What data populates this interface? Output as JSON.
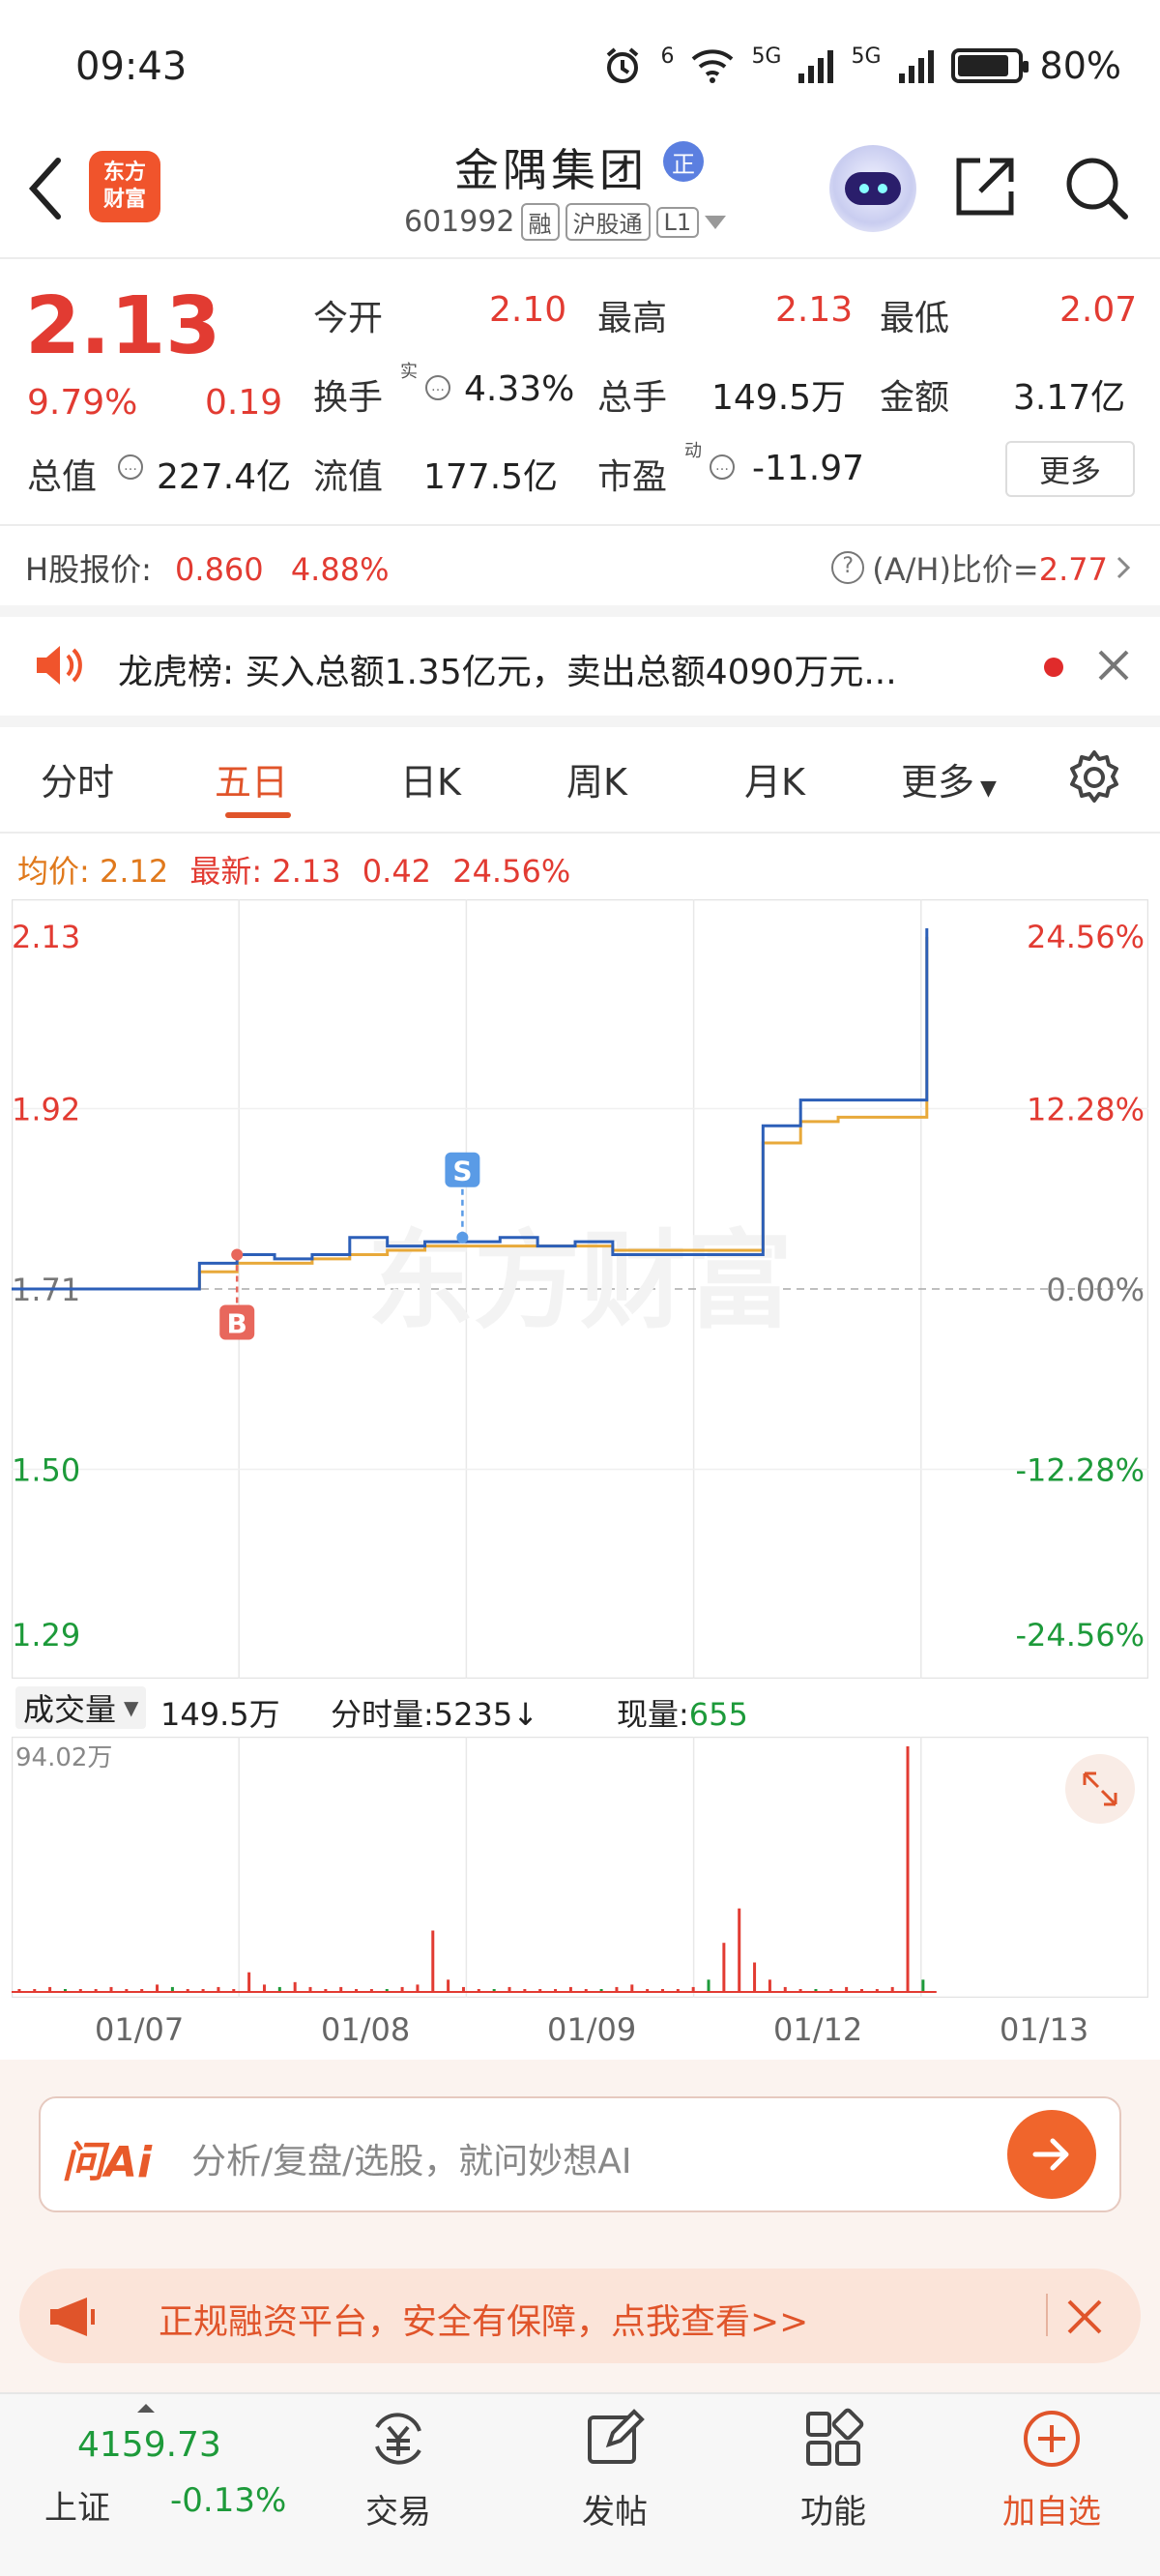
{
  "status": {
    "time": "09:43",
    "battery": "80%",
    "sig1_tag": "6",
    "sig2_tag": "5G",
    "sig3_tag": "5G"
  },
  "header": {
    "brand_line1": "东方",
    "brand_line2": "财富",
    "stock_name": "金隅集团",
    "zheng_badge": "正",
    "stock_code": "601992",
    "tags": [
      "融",
      "沪股通",
      "L1"
    ]
  },
  "quote": {
    "price": "2.13",
    "pct_chg": "9.79%",
    "amt_chg": "0.19",
    "open_label": "今开",
    "open": "2.10",
    "high_label": "最高",
    "high": "2.13",
    "low_label": "最低",
    "low": "2.07",
    "turnover_label": "换手",
    "turnover_sup": "实",
    "turnover": "4.33%",
    "volume_label": "总手",
    "volume": "149.5万",
    "amount_label": "金额",
    "amount": "3.17亿",
    "mktcap_label": "总值",
    "mktcap": "227.4亿",
    "float_label": "流值",
    "float": "177.5亿",
    "pe_label": "市盈",
    "pe_sup": "动",
    "pe": "-11.97",
    "more_label": "更多"
  },
  "hshare": {
    "label": "H股报价:",
    "price": "0.860",
    "pct": "4.88%",
    "ah_label": "(A/H)比价=",
    "ah_value": "2.77"
  },
  "dragon": {
    "text": "龙虎榜: 买入总额1.35亿元，卖出总额4090万元..."
  },
  "tabs": [
    {
      "label": "分时"
    },
    {
      "label": "五日"
    },
    {
      "label": "日K"
    },
    {
      "label": "周K"
    },
    {
      "label": "月K"
    },
    {
      "label": "更多"
    }
  ],
  "legend": {
    "avg_label": "均价:",
    "avg": "2.12",
    "latest_label": "最新:",
    "latest": "2.13",
    "chg": "0.42",
    "pct": "24.56%"
  },
  "chart_data": {
    "type": "line",
    "y_left_ticks": [
      "2.13",
      "1.92",
      "1.71",
      "1.50",
      "1.29"
    ],
    "y_right_ticks": [
      "24.56%",
      "12.28%",
      "0.00%",
      "-12.28%",
      "-24.56%"
    ],
    "ylim": [
      1.29,
      2.13
    ],
    "x_dates": [
      "01/07",
      "01/08",
      "01/09",
      "01/12",
      "01/13"
    ],
    "series": [
      {
        "values": [
          1.71,
          1.71,
          1.71,
          1.71,
          1.71,
          1.74,
          1.75,
          1.745,
          1.75,
          1.77,
          1.76,
          1.765,
          1.765,
          1.77,
          1.76,
          1.765,
          1.75,
          1.75,
          1.75,
          1.75,
          1.9,
          1.93,
          1.93,
          1.93,
          1.93,
          2.13
        ]
      },
      {
        "values": [
          1.71,
          1.71,
          1.71,
          1.71,
          1.71,
          1.73,
          1.74,
          1.74,
          1.745,
          1.75,
          1.755,
          1.76,
          1.76,
          1.76,
          1.76,
          1.76,
          1.755,
          1.755,
          1.755,
          1.755,
          1.88,
          1.905,
          1.91,
          1.91,
          1.91,
          2.12
        ]
      }
    ],
    "markers": [
      {
        "label": "B",
        "x_index": 6,
        "y": 1.75
      },
      {
        "label": "S",
        "x_index": 12,
        "y": 1.77
      }
    ],
    "volume": {
      "max_label": "94.02万",
      "bars": [
        0.01,
        0.01,
        0.02,
        0.01,
        0.01,
        0.01,
        0.02,
        0.01,
        0.01,
        0.03,
        0.02,
        0.01,
        0.01,
        0.02,
        0.01,
        0.08,
        0.03,
        0.02,
        0.04,
        0.02,
        0.01,
        0.02,
        0.01,
        0.01,
        0.01,
        0.02,
        0.03,
        0.25,
        0.05,
        0.02,
        0.01,
        0.01,
        0.02,
        0.01,
        0.01,
        0.01,
        0.02,
        0.01,
        0.01,
        0.02,
        0.03,
        0.01,
        0.01,
        0.01,
        0.02,
        0.05,
        0.2,
        0.34,
        0.12,
        0.05,
        0.02,
        0.01,
        0.01,
        0.01,
        0.02,
        0.01,
        0.01,
        0.02,
        1.0,
        0.05
      ]
    }
  },
  "volume_header": {
    "dropdown_label": "成交量",
    "total": "149.5万",
    "tick_label": "分时量:",
    "tick_value": "5235",
    "current_label": "现量:",
    "current_value": "655"
  },
  "ai": {
    "logo": "问Ai",
    "placeholder": "分析/复盘/选股，就问妙想AI"
  },
  "ad": {
    "text": "正规融资平台，安全有保障，点我查看>>"
  },
  "bottom_nav": {
    "index_value": "4159.73",
    "index_name": "上证",
    "index_chg": "-0.13%",
    "items": [
      "交易",
      "发帖",
      "功能",
      "加自选"
    ]
  },
  "colors": {
    "accent": "#e0542a",
    "up": "#e23b32",
    "down": "#1d9a3a",
    "price_line": "#2c5fb8",
    "avg_line": "#e8a93a"
  }
}
